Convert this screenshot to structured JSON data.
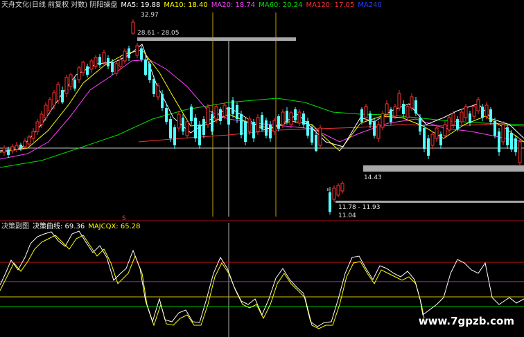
{
  "header": {
    "title": "天舟文化(日线 前复权 对数) 阴阳操盘",
    "ma5": "MA5: 19.88",
    "ma10": "MA10: 18.40",
    "ma20": "MA20: 18.74",
    "ma60": "MA60: 20.24",
    "ma120": "MA120: 17.05",
    "ma240": "MA240"
  },
  "price_labels": {
    "high": "32.97",
    "range_top": "28.61 - 28.05",
    "range_mid": "14.43",
    "range_low": "11.78 - 11.93",
    "low": "11.04",
    "marker": "S"
  },
  "sub_header": {
    "title": "决策副图",
    "line1": "决策曲线: 69.36",
    "line2": "MAJCQX: 65.28"
  },
  "watermark": "www.7gpzb.com",
  "colors": {
    "up": "#ff3030",
    "down": "#54ffff",
    "ma5": "#ffffff",
    "ma10": "#ffff00",
    "ma20": "#ff40ff",
    "ma60": "#00e000",
    "ma120": "#ff3030",
    "ma240": "#2040ff"
  }
}
